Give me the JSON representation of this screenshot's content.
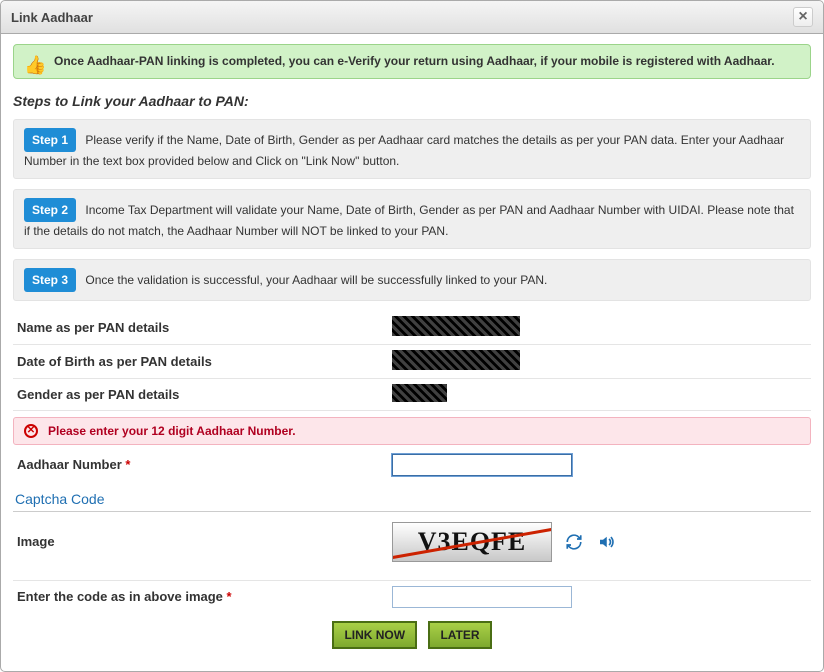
{
  "dialog": {
    "title": "Link Aadhaar"
  },
  "banner": "Once Aadhaar-PAN linking is completed, you can e-Verify your return using Aadhaar, if your mobile is registered with Aadhaar.",
  "steps_heading": "Steps to Link your Aadhaar to PAN:",
  "steps": [
    {
      "label": "Step 1",
      "text": "Please verify if the Name, Date of Birth, Gender as per Aadhaar card matches the details as per your PAN data. Enter your Aadhaar Number in the text box provided below and Click on \"Link Now\" button."
    },
    {
      "label": "Step 2",
      "text": "Income Tax Department will validate your Name, Date of Birth, Gender as per PAN and Aadhaar Number with UIDAI. Please note that if the details do not match, the Aadhaar Number will NOT be linked to your PAN."
    },
    {
      "label": "Step 3",
      "text": "Once the validation is successful, your Aadhaar will be successfully linked to your PAN."
    }
  ],
  "details": {
    "name_label": "Name as per PAN details",
    "dob_label": "Date of Birth as per PAN details",
    "gender_label": "Gender as per PAN details"
  },
  "error": "Please enter your 12 digit Aadhaar Number.",
  "form": {
    "aadhaar_label": "Aadhaar Number",
    "aadhaar_value": "",
    "captcha_legend": "Captcha Code",
    "image_label": "Image",
    "captcha_text": "V3EQFE",
    "enter_code_label": "Enter the code as in above image",
    "code_value": ""
  },
  "buttons": {
    "link_now": "LINK NOW",
    "later": "LATER"
  }
}
